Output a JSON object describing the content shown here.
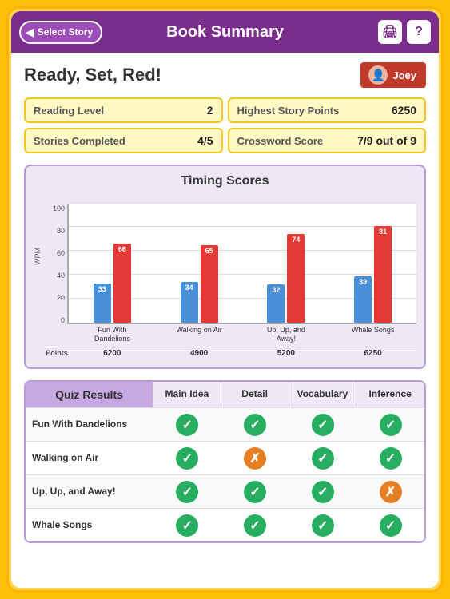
{
  "header": {
    "back_label": "Select Story",
    "title": "Book Summary",
    "print_icon": "🖨",
    "help_icon": "?"
  },
  "book": {
    "title": "Ready, Set, Red!",
    "user": "Joey"
  },
  "stats": [
    {
      "label": "Reading Level",
      "value": "2"
    },
    {
      "label": "Highest Story Points",
      "value": "6250"
    },
    {
      "label": "Stories Completed",
      "value": "4/5"
    },
    {
      "label": "Crossword Score",
      "value": "7/9 out of 9"
    }
  ],
  "chart": {
    "title": "Timing Scores",
    "y_axis": [
      "100",
      "80",
      "60",
      "40",
      "20",
      "0"
    ],
    "wpm_label": "WPM",
    "groups": [
      {
        "label": "Fun With\nDandelions",
        "blue_val": 33,
        "red_val": 66,
        "points": "6200"
      },
      {
        "label": "Walking on Air",
        "blue_val": 34,
        "red_val": 65,
        "points": "4900"
      },
      {
        "label": "Up, Up, and\nAway!",
        "blue_val": 32,
        "red_val": 74,
        "points": "5200"
      },
      {
        "label": "Whale Songs",
        "blue_val": 39,
        "red_val": 81,
        "points": "6250"
      }
    ],
    "points_label": "Points"
  },
  "quiz": {
    "title": "Quiz Results",
    "columns": [
      "Main Idea",
      "Detail",
      "Vocabulary",
      "Inference"
    ],
    "rows": [
      {
        "story": "Fun With Dandelions",
        "results": [
          "green",
          "green",
          "green",
          "green"
        ]
      },
      {
        "story": "Walking on Air",
        "results": [
          "green",
          "orange",
          "green",
          "green"
        ]
      },
      {
        "story": "Up, Up, and Away!",
        "results": [
          "green",
          "green",
          "green",
          "orange"
        ]
      },
      {
        "story": "Whale Songs",
        "results": [
          "green",
          "green",
          "green",
          "green"
        ]
      }
    ]
  }
}
